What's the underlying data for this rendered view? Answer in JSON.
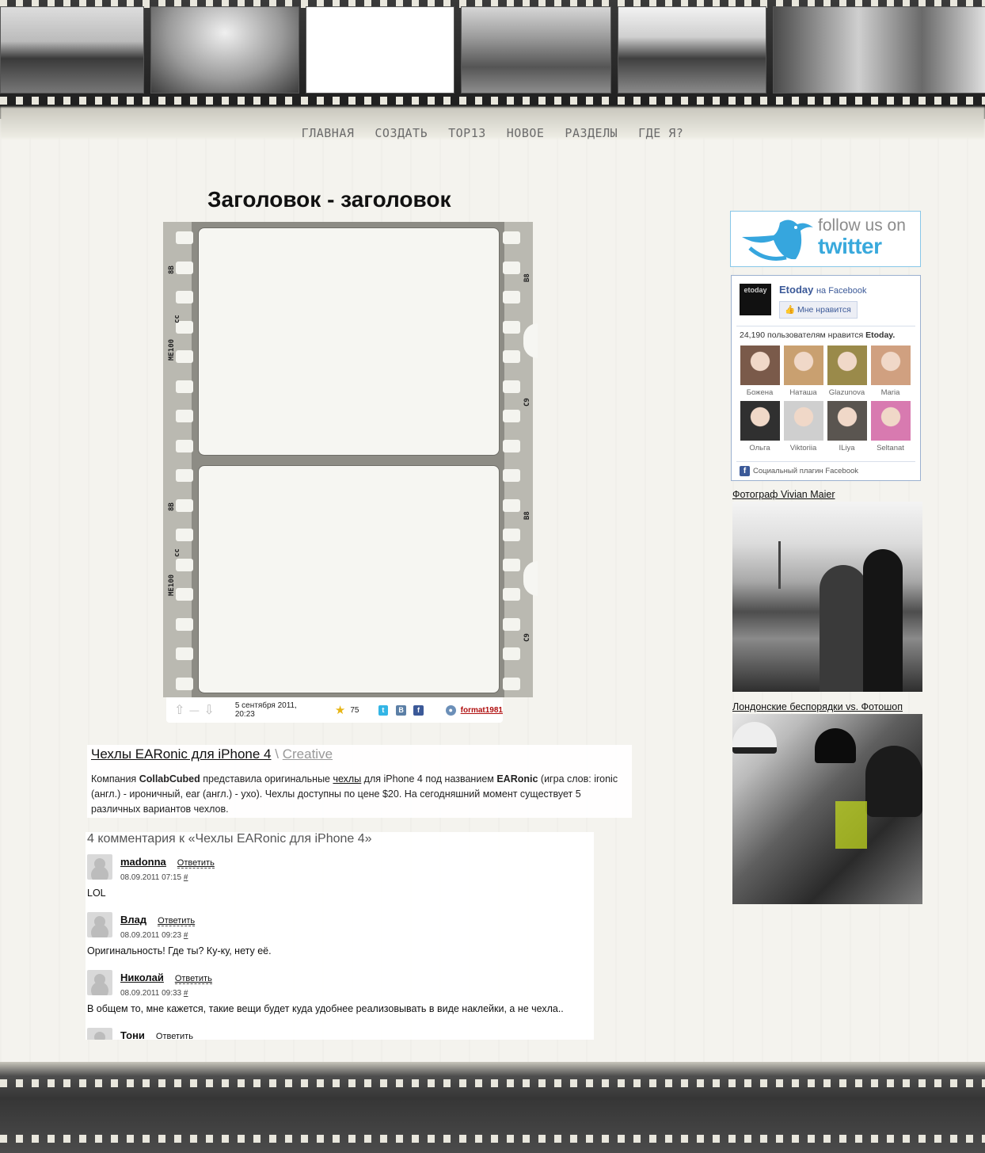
{
  "nav": {
    "items": [
      "ГЛАВНАЯ",
      "СОЗДАТЬ",
      "TOP13",
      "НОВОЕ",
      "РАЗДЕЛЫ",
      "ГДЕ Я?"
    ]
  },
  "post": {
    "title": "Заголовок  - заголовок",
    "filmstrip_codes": [
      "8B",
      "cc",
      "ME100",
      "cc",
      "B8",
      "C9"
    ],
    "meta": {
      "vote_separator": "—",
      "date": "5 сентября 2011, 20:23",
      "rating": "75",
      "share_icons": [
        "twitter-icon",
        "vkontakte-icon",
        "facebook-icon"
      ],
      "author": "format1981"
    }
  },
  "article": {
    "title": "Чехлы EARonic для iPhone 4",
    "separator": "\\",
    "category": "Creative",
    "body_pre": "Компания ",
    "body_company": "CollabCubed",
    "body_mid1": " представила оригинальные ",
    "body_link": "чехлы",
    "body_mid2": " для iPhone 4 под названием ",
    "body_product": "EARonic",
    "body_post": " (игра слов: ironic (англ.) - ироничный, ear (англ.) - ухо). Чехлы доступны по цене $20. На сегодняшний момент существует 5 различных вариантов чехлов."
  },
  "comments": {
    "heading": "4 комментария к «Чехлы EARonic для iPhone 4»",
    "reply_label": "Ответить",
    "hash": "#",
    "items": [
      {
        "author": "madonna",
        "date": "08.09.2011 07:15",
        "text": "LOL"
      },
      {
        "author": "Влад",
        "date": "08.09.2011 09:23",
        "text": "Оригинальность! Где ты? Ку-ку, нету её."
      },
      {
        "author": "Николай",
        "date": "08.09.2011 09:33",
        "text": "В общем то, мне кажется, такие вещи будет куда удобнее реализовывать в виде наклейки, а не чехла.."
      },
      {
        "author": "Тони",
        "date": "",
        "text": ""
      }
    ]
  },
  "sidebar": {
    "twitter": {
      "line1": "follow us on",
      "line2": "twitter"
    },
    "facebook": {
      "logo_text": "etoday",
      "page_name": "Etoday",
      "on_facebook": "на Facebook",
      "like_label": "Мне нравится",
      "count_text": "24,190 пользователям нравится ",
      "count_page": "Etoday.",
      "faces": [
        {
          "name": "Божена",
          "color": "#7a5a4a"
        },
        {
          "name": "Наташа",
          "color": "#c9a070"
        },
        {
          "name": "Glazunova",
          "color": "#9a8a4a"
        },
        {
          "name": "Maria",
          "color": "#d0a080"
        },
        {
          "name": "Ольга",
          "color": "#303030"
        },
        {
          "name": "Viktoriia",
          "color": "#cfcfcf"
        },
        {
          "name": "ILiya",
          "color": "#5a5550"
        },
        {
          "name": "Seltanat",
          "color": "#d87ab0"
        }
      ],
      "plugin_label": "Социальный плагин Facebook"
    },
    "links": [
      {
        "title": "Фотограф Vivian Maier"
      },
      {
        "title": "Лондонские беспорядки vs. Фотошоп"
      }
    ]
  }
}
